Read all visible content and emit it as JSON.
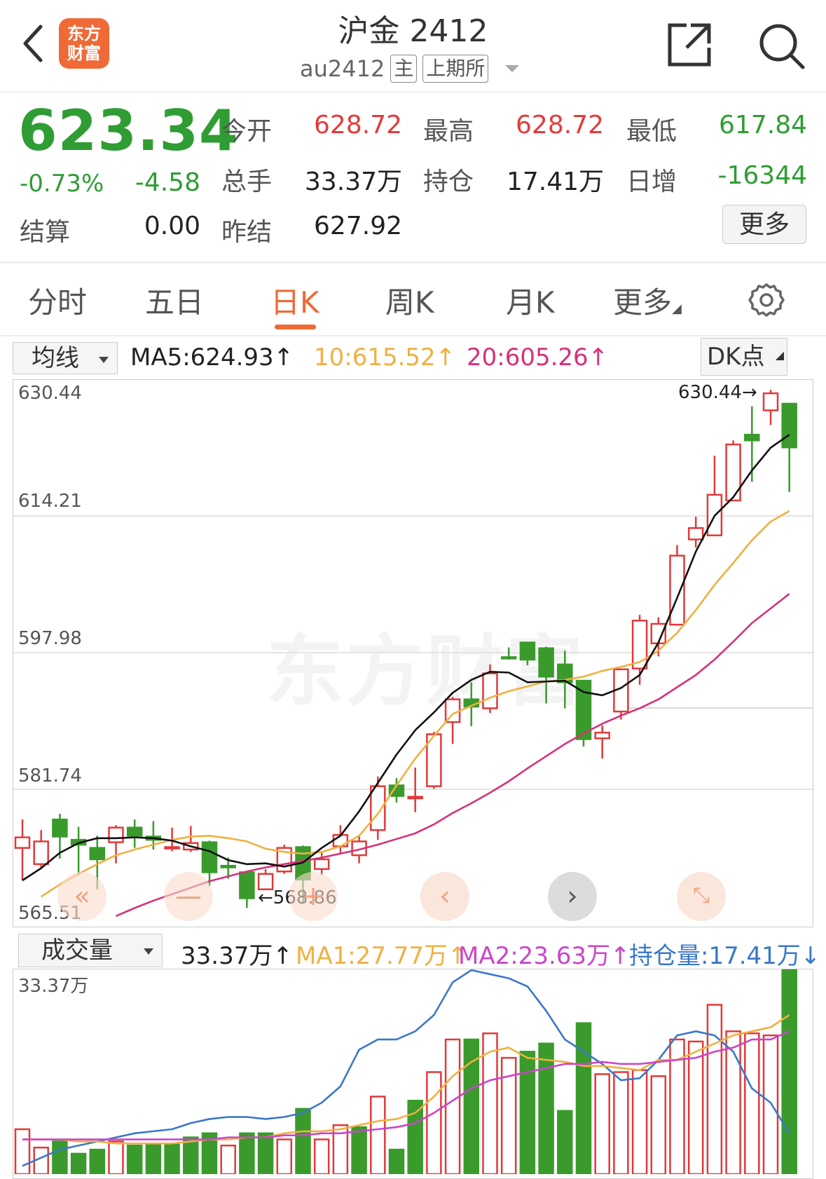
{
  "header": {
    "title": "沪金 2412",
    "code": "au2412",
    "tag_main": "主",
    "tag_exchange": "上期所",
    "logo_line1": "东方",
    "logo_line2": "财富"
  },
  "quote": {
    "price": "623.34",
    "change_pct": "-0.73%",
    "change": "-4.58",
    "settle_label": "结算",
    "settle_value": "0.00",
    "rows": [
      {
        "label": "今开",
        "value": "628.72"
      },
      {
        "label": "最高",
        "value": "628.72"
      },
      {
        "label": "最低",
        "value": "617.84"
      },
      {
        "label": "总手",
        "value": "33.37万"
      },
      {
        "label": "持仓",
        "value": "17.41万"
      },
      {
        "label": "日增",
        "value": "-16344"
      },
      {
        "label": "昨结",
        "value": "627.92"
      }
    ],
    "more_label": "更多"
  },
  "tabs": [
    {
      "label": "分时"
    },
    {
      "label": "五日"
    },
    {
      "label": "日K"
    },
    {
      "label": "周K"
    },
    {
      "label": "月K"
    },
    {
      "label": "更多"
    }
  ],
  "kline_bar": {
    "selector": "均线",
    "ma5": "MA5:624.93↑",
    "ma10": "10:615.52↑",
    "ma20": "20:605.26↑",
    "dk_label": "DK点",
    "colors": {
      "ma5": "#111111",
      "ma10": "#f0b040",
      "ma20": "#d6317a"
    }
  },
  "volume_bar": {
    "selector": "成交量",
    "vol": "33.37万↑",
    "ma1": "MA1:27.77万↑",
    "ma2": "MA2:23.63万↑",
    "oi": "持仓量:17.41万↓",
    "colors": {
      "ma1": "#f0b040",
      "ma2": "#cc44cc",
      "oi": "#3a78c9"
    }
  },
  "annotations": {
    "high": "630.44→",
    "low": "←568.86"
  },
  "watermark": "东方财富",
  "chart_data": {
    "type": "candlestick",
    "y_ticks": [
      "630.44",
      "614.21",
      "597.98",
      "581.74",
      "565.51"
    ],
    "ylim": [
      565.51,
      630.44
    ],
    "volume_max_label": "33.37万",
    "candles": [
      {
        "o": 574.0,
        "c": 575.3,
        "h": 577.5,
        "l": 570.0
      },
      {
        "o": 572.0,
        "c": 574.8,
        "h": 576.2,
        "l": 571.5
      },
      {
        "o": 577.5,
        "c": 575.4,
        "h": 578.2,
        "l": 572.7
      },
      {
        "o": 575.0,
        "c": 574.4,
        "h": 576.6,
        "l": 570.6
      },
      {
        "o": 574.0,
        "c": 572.6,
        "h": 575.5,
        "l": 568.9
      },
      {
        "o": 574.7,
        "c": 576.5,
        "h": 576.8,
        "l": 572.1
      },
      {
        "o": 576.5,
        "c": 575.5,
        "h": 577.5,
        "l": 574.0
      },
      {
        "o": 575.4,
        "c": 575.0,
        "h": 577.3,
        "l": 573.8
      },
      {
        "o": 574.0,
        "c": 574.1,
        "h": 576.5,
        "l": 573.6
      },
      {
        "o": 573.8,
        "c": 574.6,
        "h": 576.7,
        "l": 573.5
      },
      {
        "o": 574.7,
        "c": 571.0,
        "h": 574.9,
        "l": 569.3
      },
      {
        "o": 571.8,
        "c": 571.6,
        "h": 572.8,
        "l": 570.2
      },
      {
        "o": 571.0,
        "c": 567.8,
        "h": 571.1,
        "l": 566.6
      },
      {
        "o": 568.9,
        "c": 570.8,
        "h": 571.4,
        "l": 568.9
      },
      {
        "o": 571.1,
        "c": 574.0,
        "h": 574.4,
        "l": 570.8
      },
      {
        "o": 574.1,
        "c": 570.1,
        "h": 574.3,
        "l": 567.3
      },
      {
        "o": 571.4,
        "c": 572.6,
        "h": 573.4,
        "l": 570.7
      },
      {
        "o": 574.2,
        "c": 575.6,
        "h": 576.8,
        "l": 573.3
      },
      {
        "o": 573.1,
        "c": 574.8,
        "h": 575.5,
        "l": 572.1
      },
      {
        "o": 576.2,
        "c": 581.6,
        "h": 582.8,
        "l": 575.0
      },
      {
        "o": 581.7,
        "c": 580.4,
        "h": 582.6,
        "l": 579.6
      },
      {
        "o": 580.1,
        "c": 580.3,
        "h": 583.9,
        "l": 578.4
      },
      {
        "o": 581.6,
        "c": 588.0,
        "h": 588.3,
        "l": 581.3
      },
      {
        "o": 589.5,
        "c": 592.3,
        "h": 592.6,
        "l": 586.8
      },
      {
        "o": 592.3,
        "c": 591.4,
        "h": 594.4,
        "l": 589.0
      },
      {
        "o": 591.2,
        "c": 595.5,
        "h": 596.6,
        "l": 590.6
      },
      {
        "o": 597.5,
        "c": 597.4,
        "h": 598.7,
        "l": 597.2
      },
      {
        "o": 599.3,
        "c": 597.2,
        "h": 599.4,
        "l": 596.5
      },
      {
        "o": 598.6,
        "c": 595.1,
        "h": 598.8,
        "l": 591.8
      },
      {
        "o": 596.6,
        "c": 594.4,
        "h": 598.3,
        "l": 591.2
      },
      {
        "o": 594.6,
        "c": 587.4,
        "h": 594.6,
        "l": 586.5
      },
      {
        "o": 587.5,
        "c": 588.2,
        "h": 589.1,
        "l": 585.0
      },
      {
        "o": 590.8,
        "c": 596.0,
        "h": 596.1,
        "l": 589.8
      },
      {
        "o": 596.1,
        "c": 602.0,
        "h": 602.7,
        "l": 594.1
      },
      {
        "o": 599.2,
        "c": 601.6,
        "h": 602.4,
        "l": 597.6
      },
      {
        "o": 601.5,
        "c": 610.0,
        "h": 611.3,
        "l": 601.5
      },
      {
        "o": 612.0,
        "c": 613.4,
        "h": 614.8,
        "l": 611.0
      },
      {
        "o": 612.5,
        "c": 617.5,
        "h": 622.3,
        "l": 612.5
      },
      {
        "o": 616.8,
        "c": 623.7,
        "h": 624.2,
        "l": 616.7
      },
      {
        "o": 624.9,
        "c": 624.2,
        "h": 628.4,
        "l": 619.1
      },
      {
        "o": 627.9,
        "c": 630.0,
        "h": 630.44,
        "l": 626.1
      },
      {
        "o": 628.72,
        "c": 623.34,
        "h": 628.72,
        "l": 617.84
      }
    ],
    "ma5": [
      570.0,
      571.5,
      573.4,
      574.6,
      575.2,
      575.2,
      575.3,
      575.2,
      574.9,
      574.2,
      573.6,
      572.5,
      572.0,
      572.1,
      571.7,
      572.2,
      574.0,
      575.5,
      578.5,
      582.0,
      585.5,
      588.5,
      590.7,
      593.1,
      594.7,
      595.7,
      595.6,
      594.4,
      594.5,
      594.6,
      593.2,
      592.8,
      593.7,
      595.3,
      599.3,
      604.8,
      610.5,
      614.9,
      617.2,
      620.5,
      623.3,
      624.9
    ],
    "ma10": [
      568.0,
      569.5,
      570.8,
      572.0,
      573.1,
      573.8,
      574.4,
      575.0,
      575.4,
      575.5,
      575.2,
      574.8,
      573.9,
      573.5,
      573.3,
      573.5,
      574.2,
      575.5,
      578.2,
      581.7,
      585.0,
      587.8,
      590.5,
      591.5,
      592.5,
      593.3,
      593.9,
      594.5,
      594.7,
      595.1,
      595.8,
      596.3,
      596.9,
      598.3,
      600.5,
      603.3,
      606.4,
      609.1,
      611.9,
      614.2,
      615.5
    ],
    "ma20": [
      565.6,
      566.6,
      567.5,
      568.3,
      569.1,
      569.9,
      570.5,
      571.1,
      571.6,
      572.0,
      572.4,
      572.8,
      573.3,
      573.8,
      574.4,
      575.1,
      575.8,
      576.9,
      578.3,
      579.5,
      580.8,
      582.2,
      583.8,
      585.3,
      586.8,
      588.1,
      589.3,
      590.3,
      591.2,
      592.3,
      593.8,
      595.3,
      597.2,
      599.4,
      601.7,
      603.5,
      605.3
    ],
    "volume": [
      {
        "v": 0.22,
        "up": true
      },
      {
        "v": 0.13,
        "up": true
      },
      {
        "v": 0.16,
        "up": false
      },
      {
        "v": 0.1,
        "up": false
      },
      {
        "v": 0.12,
        "up": false
      },
      {
        "v": 0.16,
        "up": true
      },
      {
        "v": 0.14,
        "up": false
      },
      {
        "v": 0.15,
        "up": false
      },
      {
        "v": 0.15,
        "up": false
      },
      {
        "v": 0.18,
        "up": false
      },
      {
        "v": 0.2,
        "up": false
      },
      {
        "v": 0.14,
        "up": true
      },
      {
        "v": 0.2,
        "up": false
      },
      {
        "v": 0.2,
        "up": false
      },
      {
        "v": 0.17,
        "up": true
      },
      {
        "v": 0.32,
        "up": false
      },
      {
        "v": 0.17,
        "up": true
      },
      {
        "v": 0.24,
        "up": true
      },
      {
        "v": 0.23,
        "up": false
      },
      {
        "v": 0.38,
        "up": true
      },
      {
        "v": 0.12,
        "up": false
      },
      {
        "v": 0.36,
        "up": false
      },
      {
        "v": 0.5,
        "up": true
      },
      {
        "v": 0.66,
        "up": true
      },
      {
        "v": 0.66,
        "up": false
      },
      {
        "v": 0.69,
        "up": true
      },
      {
        "v": 0.57,
        "up": true
      },
      {
        "v": 0.6,
        "up": false
      },
      {
        "v": 0.64,
        "up": false
      },
      {
        "v": 0.31,
        "up": false
      },
      {
        "v": 0.74,
        "up": false
      },
      {
        "v": 0.49,
        "up": true
      },
      {
        "v": 0.5,
        "up": true
      },
      {
        "v": 0.51,
        "up": true
      },
      {
        "v": 0.48,
        "up": true
      },
      {
        "v": 0.66,
        "up": true
      },
      {
        "v": 0.65,
        "up": true
      },
      {
        "v": 0.83,
        "up": true
      },
      {
        "v": 0.7,
        "up": true
      },
      {
        "v": 0.69,
        "up": true
      },
      {
        "v": 0.68,
        "up": true
      },
      {
        "v": 1.0,
        "up": false
      }
    ],
    "vol_ma1": [
      0.17,
      0.17,
      0.17,
      0.16,
      0.16,
      0.15,
      0.15,
      0.15,
      0.15,
      0.16,
      0.17,
      0.17,
      0.18,
      0.18,
      0.2,
      0.21,
      0.21,
      0.22,
      0.24,
      0.26,
      0.27,
      0.3,
      0.38,
      0.48,
      0.55,
      0.6,
      0.62,
      0.57,
      0.56,
      0.55,
      0.53,
      0.53,
      0.52,
      0.51,
      0.56,
      0.56,
      0.6,
      0.64,
      0.68,
      0.7,
      0.72,
      0.78
    ],
    "vol_ma2": [
      0.17,
      0.17,
      0.17,
      0.17,
      0.17,
      0.17,
      0.17,
      0.17,
      0.17,
      0.17,
      0.17,
      0.18,
      0.18,
      0.18,
      0.19,
      0.19,
      0.2,
      0.2,
      0.21,
      0.22,
      0.23,
      0.25,
      0.3,
      0.36,
      0.42,
      0.46,
      0.48,
      0.5,
      0.52,
      0.54,
      0.54,
      0.55,
      0.54,
      0.54,
      0.55,
      0.56,
      0.57,
      0.6,
      0.62,
      0.66,
      0.66,
      0.7
    ],
    "open_interest": [
      0.04,
      0.08,
      0.12,
      0.14,
      0.16,
      0.18,
      0.2,
      0.21,
      0.22,
      0.25,
      0.27,
      0.28,
      0.28,
      0.27,
      0.28,
      0.3,
      0.35,
      0.43,
      0.61,
      0.66,
      0.66,
      0.7,
      0.78,
      0.94,
      1.0,
      0.98,
      0.96,
      0.92,
      0.8,
      0.66,
      0.6,
      0.54,
      0.46,
      0.47,
      0.56,
      0.68,
      0.7,
      0.68,
      0.6,
      0.42,
      0.35,
      0.2
    ]
  }
}
